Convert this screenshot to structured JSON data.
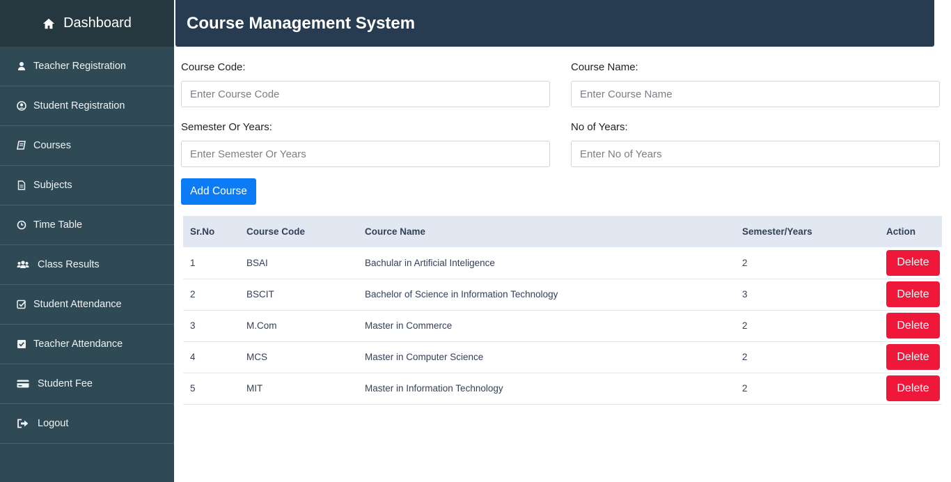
{
  "sidebar": {
    "title": "Dashboard",
    "items": [
      {
        "label": "Teacher Registration",
        "icon": "user-icon"
      },
      {
        "label": "Student Registration",
        "icon": "user-circle-icon"
      },
      {
        "label": "Courses",
        "icon": "book-icon"
      },
      {
        "label": "Subjects",
        "icon": "file-icon"
      },
      {
        "label": "Time Table",
        "icon": "clock-icon"
      },
      {
        "label": "Class Results",
        "icon": "users-icon"
      },
      {
        "label": "Student Attendance",
        "icon": "check-square-outline-icon"
      },
      {
        "label": "Teacher Attendance",
        "icon": "check-square-icon"
      },
      {
        "label": "Student Fee",
        "icon": "credit-card-icon"
      },
      {
        "label": "Logout",
        "icon": "sign-out-icon"
      }
    ]
  },
  "header": {
    "title": "Course Management System"
  },
  "form": {
    "course_code": {
      "label": "Course Code:",
      "placeholder": "Enter Course Code",
      "value": ""
    },
    "course_name": {
      "label": "Course Name:",
      "placeholder": "Enter Course Name",
      "value": ""
    },
    "semester": {
      "label": "Semester Or Years:",
      "placeholder": "Enter Semester Or Years",
      "value": ""
    },
    "years": {
      "label": "No of Years:",
      "placeholder": "Enter No of Years",
      "value": ""
    },
    "submit_label": "Add Course"
  },
  "table": {
    "columns": [
      "Sr.No",
      "Course Code",
      "Cource Name",
      "Semester/Years",
      "Action"
    ],
    "rows": [
      {
        "sr": "1",
        "code": "BSAI",
        "name": "Bachular in Artificial Inteligence",
        "sem": "2",
        "action": "Delete"
      },
      {
        "sr": "2",
        "code": "BSCIT",
        "name": "Bachelor of Science in Information Technology",
        "sem": "3",
        "action": "Delete"
      },
      {
        "sr": "3",
        "code": "M.Com",
        "name": "Master in Commerce",
        "sem": "2",
        "action": "Delete"
      },
      {
        "sr": "4",
        "code": "MCS",
        "name": "Master in Computer Science",
        "sem": "2",
        "action": "Delete"
      },
      {
        "sr": "5",
        "code": "MIT",
        "name": "Master in Information Technology",
        "sem": "2",
        "action": "Delete"
      }
    ]
  },
  "colors": {
    "sidebar_bg": "#2f4a54",
    "sidebar_head_bg": "#25383f",
    "header_bg": "#273c50",
    "primary": "#0b7cf6",
    "danger": "#f0183a",
    "table_head_bg": "#e1e8f1"
  }
}
